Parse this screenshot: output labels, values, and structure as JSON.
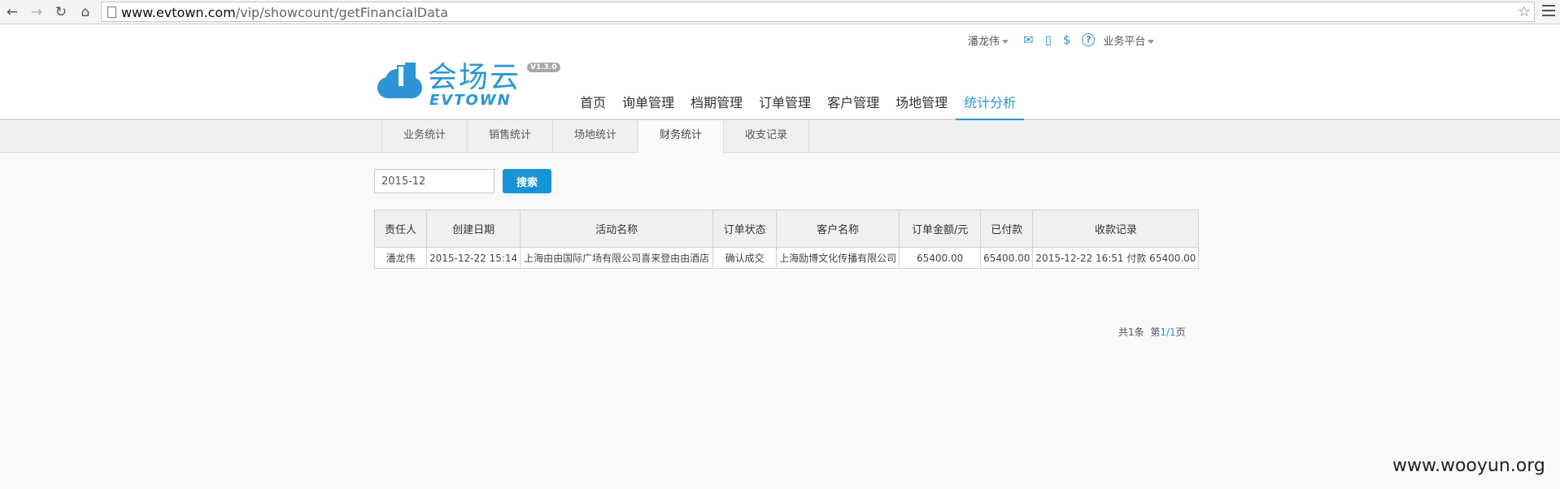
{
  "browser": {
    "url_domain": "www.evtown.com",
    "url_path": "/vip/showcount/getFinancialData",
    "back_glyph": "←",
    "forward_glyph": "→",
    "reload_glyph": "↻",
    "home_glyph": "⌂",
    "star_glyph": "☆"
  },
  "topbar": {
    "user": "潘龙伟",
    "platform": "业务平台",
    "mail_glyph": "✉",
    "mobile_glyph": "▯",
    "money_glyph": "$",
    "help_glyph": "?"
  },
  "logo": {
    "cn": "会场云",
    "en": "EVTOWN",
    "version": "V1.3.0",
    "brand_color": "#2b95d6"
  },
  "main_nav": [
    "首页",
    "询单管理",
    "档期管理",
    "订单管理",
    "客户管理",
    "场地管理",
    "统计分析"
  ],
  "main_nav_active": 6,
  "sub_nav": [
    "业务统计",
    "销售统计",
    "场地统计",
    "财务统计",
    "收支记录"
  ],
  "sub_nav_active": 3,
  "search": {
    "value": "2015-12",
    "button": "搜索"
  },
  "table": {
    "headers": [
      "责任人",
      "创建日期",
      "活动名称",
      "订单状态",
      "客户名称",
      "订单金额/元",
      "已付款",
      "收款记录"
    ],
    "rows": [
      [
        "潘龙伟",
        "2015-12-22 15:14",
        "上海由由国际广场有限公司喜来登由由酒店",
        "确认成交",
        "上海励博文化传播有限公司",
        "65400.00",
        "65400.00",
        "2015-12-22 16:51 付款 65400.00"
      ]
    ]
  },
  "pagination": {
    "prefix": "共",
    "total": "1",
    "unit": "条",
    "page_prefix": "第",
    "current": "1",
    "sep": "/",
    "pages": "1",
    "page_suffix": "页"
  },
  "watermark": "www.wooyun.org"
}
